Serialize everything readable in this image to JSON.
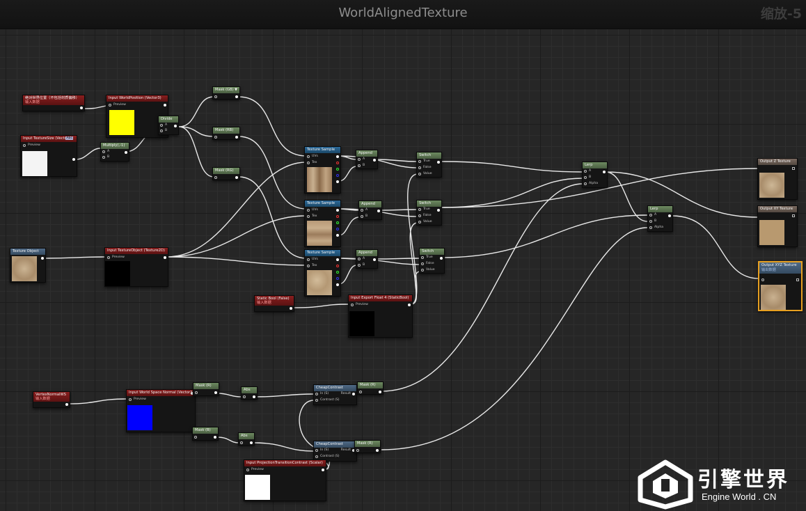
{
  "window": {
    "title": "WorldAlignedTexture",
    "zoom": "缩放-5"
  },
  "colors": {
    "wire": "#e8e8e8",
    "red_header": "#7a1a1a",
    "blue_header": "#2c6a9a",
    "green_header": "#5f7a54",
    "selected_outline": "#e8a020"
  },
  "nodes": {
    "comment_world_pos": {
      "title": "绝对世界位置（不包括材质偏移）",
      "subtitle": "输入数据"
    },
    "input_world_position": {
      "title": "Input WorldPosition (Vector3)",
      "preview": "Preview"
    },
    "input_texture_size": {
      "title": "Input TextureSize (Vector3)",
      "preview": "Preview",
      "badge": "Abc"
    },
    "divide": {
      "title": "Divide",
      "a": "A",
      "b": "B"
    },
    "multiply": {
      "title": "Multiply(,-1)",
      "a": "A",
      "b": "B"
    },
    "mask_gb": {
      "title": "Mask (GB)"
    },
    "mask_rb": {
      "title": "Mask (RB)"
    },
    "mask_rg": {
      "title": "Mask (RG)"
    },
    "texture_sample_1": {
      "title": "Texture Sample",
      "uvs": "UVs",
      "tex": "Tex"
    },
    "texture_sample_2": {
      "title": "Texture Sample",
      "uvs": "UVs",
      "tex": "Tex"
    },
    "texture_sample_3": {
      "title": "Texture Sample",
      "uvs": "UVs",
      "tex": "Tex"
    },
    "append_1": {
      "title": "Append",
      "a": "A",
      "b": "B"
    },
    "append_2": {
      "title": "Append",
      "a": "A",
      "b": "B"
    },
    "append_3": {
      "title": "Append",
      "a": "A",
      "b": "B"
    },
    "switch_1": {
      "title": "Switch",
      "t": "True",
      "f": "False",
      "v": "Value"
    },
    "switch_2": {
      "title": "Switch",
      "t": "True",
      "f": "False",
      "v": "Value"
    },
    "switch_3": {
      "title": "Switch",
      "t": "True",
      "f": "False",
      "v": "Value"
    },
    "texture_object": {
      "title": "Texture Object"
    },
    "input_texture_object": {
      "title": "Input TextureObject (Texture2D)",
      "preview": "Preview"
    },
    "static_bool": {
      "title": "Static Bool (False)",
      "subtitle": "输入数据"
    },
    "input_export_float4": {
      "title": "Input Export Float 4 (StaticBool)",
      "preview": "Preview"
    },
    "lerp_1": {
      "title": "Lerp",
      "a": "A",
      "b": "B",
      "alpha": "Alpha"
    },
    "lerp_2": {
      "title": "Lerp",
      "a": "A",
      "b": "B",
      "alpha": "Alpha"
    },
    "output_z": {
      "title": "Output Z Texture"
    },
    "output_xy": {
      "title": "Output XY Texture"
    },
    "output_xyz": {
      "title": "Output XYZ Texture",
      "subtitle": "输出数据"
    },
    "vertex_normal": {
      "title": "VertexNormalWS",
      "subtitle": "输入数据"
    },
    "input_world_normal": {
      "title": "Input World Space Normal (Vector3)",
      "preview": "Preview"
    },
    "mask_r_1": {
      "title": "Mask (R)"
    },
    "mask_b_1": {
      "title": "Mask (B)"
    },
    "abs_1": {
      "title": "Abs"
    },
    "abs_2": {
      "title": "Abs"
    },
    "cheap_contrast_1": {
      "title": "CheapContrast",
      "in": "In (S)",
      "contrast": "Contrast (S)",
      "result": "Result"
    },
    "cheap_contrast_2": {
      "title": "CheapContrast",
      "in": "In (S)",
      "contrast": "Contrast (S)",
      "result": "Result"
    },
    "mask_r_2": {
      "title": "Mask (R)"
    },
    "mask_r_3": {
      "title": "Mask (R)"
    },
    "input_projection": {
      "title": "Input ProjectionTransitionContrast (Scalar)",
      "preview": "Preview"
    }
  },
  "watermark": {
    "name_cn": "引擎世界",
    "name_en": "Engine World . CN"
  }
}
